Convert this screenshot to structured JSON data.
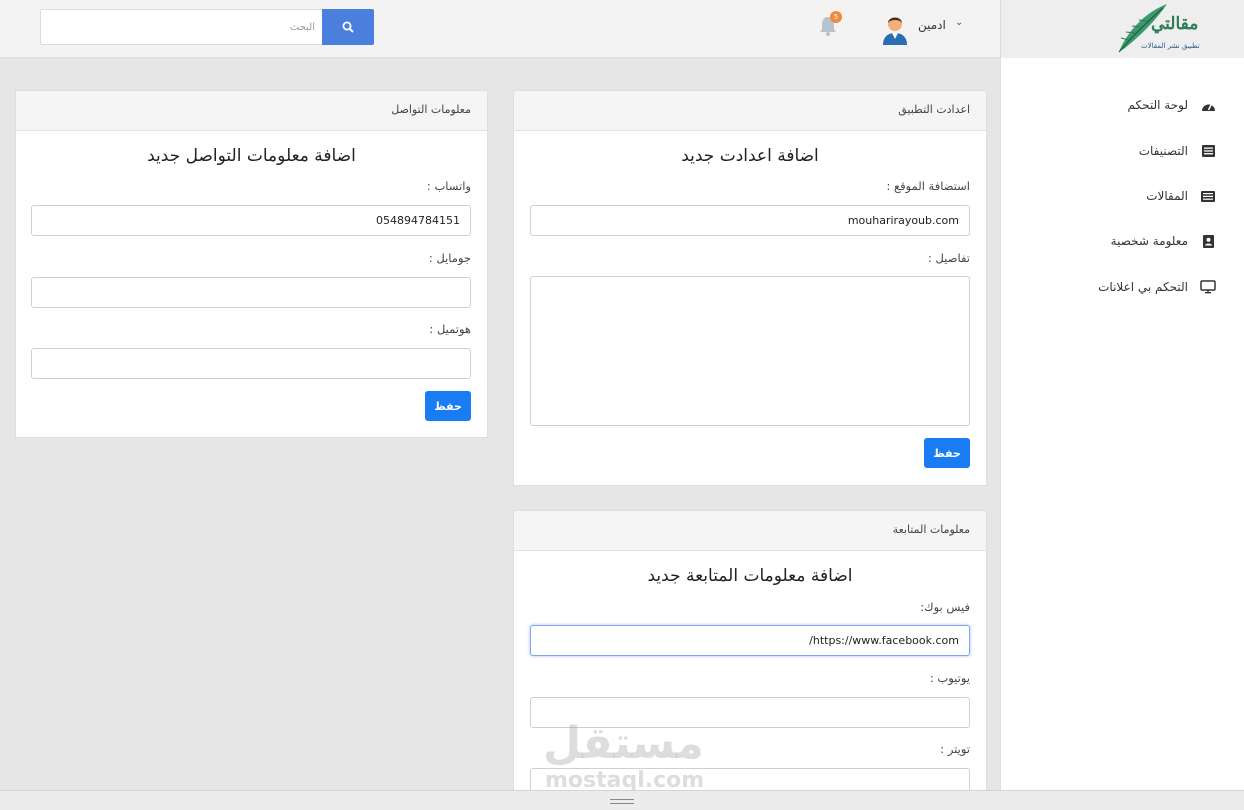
{
  "header": {
    "logo_title": "مقالتي",
    "logo_subtitle": "تطبيق نشر المقالات",
    "search_placeholder": "البحث",
    "notification_count": "5",
    "user_name": "ادمين",
    "colors": {
      "accent": "#4a7fde",
      "badge": "#f08a3c",
      "brand_green": "#2e7d5b"
    }
  },
  "sidebar": {
    "items": [
      {
        "label": "لوحة التحكم",
        "icon": "dashboard-icon"
      },
      {
        "label": "التصنيفات",
        "icon": "list-icon"
      },
      {
        "label": "المقالات",
        "icon": "articles-icon"
      },
      {
        "label": "معلومة شخصية",
        "icon": "contact-card-icon"
      },
      {
        "label": "التحكم بي اعلانات",
        "icon": "monitor-icon"
      }
    ]
  },
  "app_settings": {
    "header": "اعدادت التطبيق",
    "title": "اضافة اعدادت جديد",
    "hosting_label": "استضافة الموقع :",
    "hosting_value": "mouharirayoub.com",
    "details_label": "تفاصيل :",
    "details_value": "",
    "save_label": "حفظ"
  },
  "contact_info": {
    "header": "معلومات التواصل",
    "title": "اضافة معلومات التواصل جديد",
    "whatsapp_label": "واتساب :",
    "whatsapp_value": "054894784151",
    "mobile_label": "جومايل :",
    "mobile_value": "",
    "phone_label": "هوتميل :",
    "phone_value": "",
    "save_label": "حفظ"
  },
  "follow_info": {
    "header": "معلومات المتابعة",
    "title": "اضافة معلومات المتابعة جديد",
    "facebook_label": "فيس بوك:",
    "facebook_value": "https://www.facebook.com/",
    "youtube_label": "يوتيوب :",
    "youtube_value": "",
    "twitter_label": "تويتر :",
    "twitter_value": ""
  },
  "watermark": {
    "arabic": "مستقل",
    "latin": "mostaql.com"
  }
}
